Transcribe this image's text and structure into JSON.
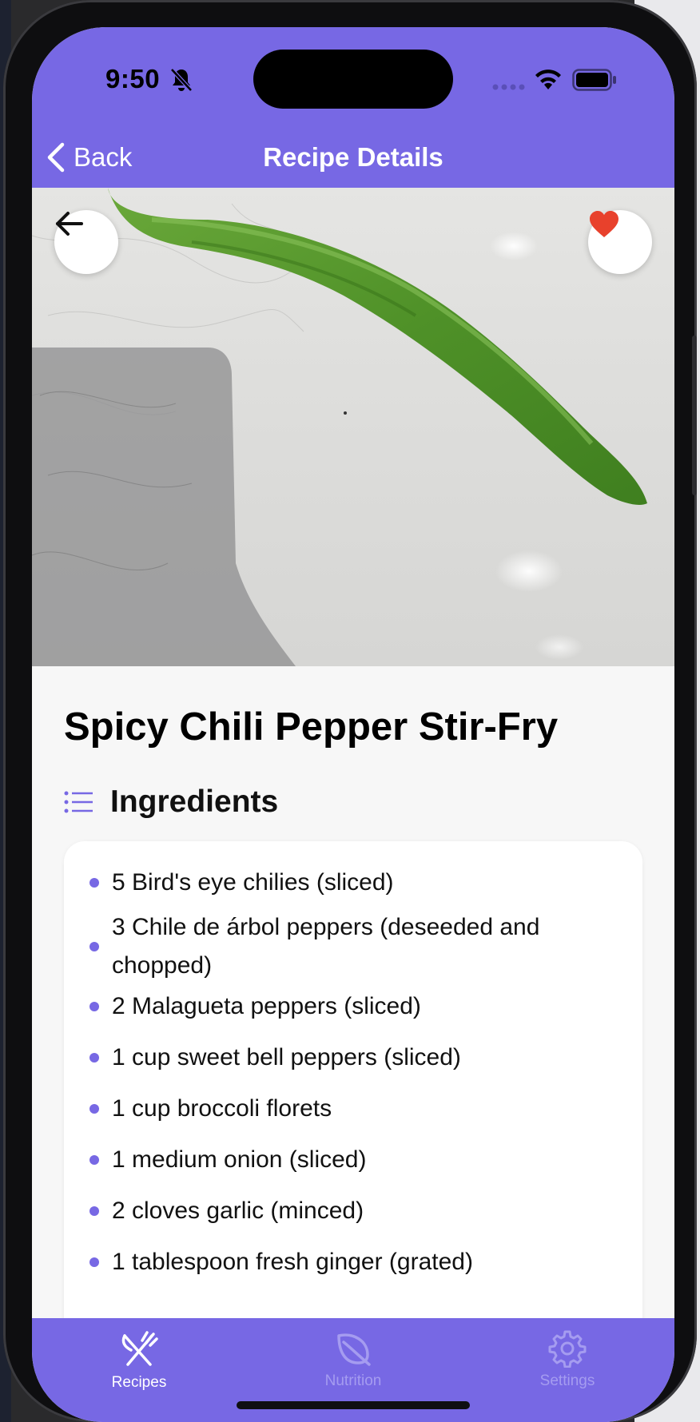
{
  "status_bar": {
    "time": "9:50",
    "icons": [
      "bell-slash-icon",
      "signal-dots-icon",
      "wifi-icon",
      "battery-icon"
    ]
  },
  "nav": {
    "back_label": "Back",
    "title": "Recipe Details"
  },
  "hero": {
    "back_icon": "arrow-left-icon",
    "favorite_icon": "heart-icon",
    "favorite_color": "#e8412c"
  },
  "recipe": {
    "title": "Spicy Chili Pepper Stir-Fry",
    "ingredients_heading": "Ingredients",
    "ingredients": [
      "5 Bird's eye chilies (sliced)",
      "3 Chile de árbol peppers (deseeded and chopped)",
      "2 Malagueta peppers (sliced)",
      "1 cup sweet bell peppers (sliced)",
      "1 cup broccoli florets",
      "1 medium onion (sliced)",
      "2 cloves garlic (minced)",
      "1 tablespoon fresh ginger (grated)"
    ]
  },
  "tabs": [
    {
      "label": "Recipes",
      "icon": "fork-knife-icon",
      "active": true
    },
    {
      "label": "Nutrition",
      "icon": "leaf-icon",
      "active": false
    },
    {
      "label": "Settings",
      "icon": "gear-icon",
      "active": false
    }
  ],
  "colors": {
    "accent": "#7768e4",
    "tab_inactive": "#a59cf0",
    "bullet": "#7768e4"
  }
}
